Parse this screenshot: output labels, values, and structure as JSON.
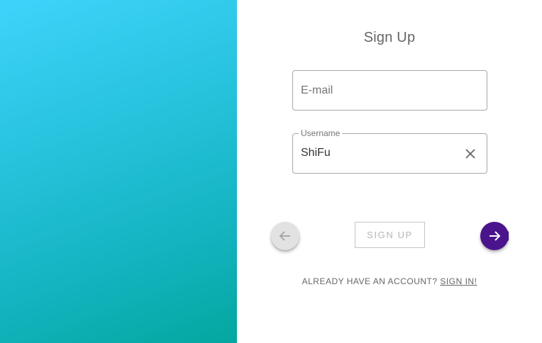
{
  "hero": {
    "gradient_start": "#3fd3fb",
    "gradient_end": "#04a79f"
  },
  "form": {
    "title": "Sign Up",
    "email": {
      "placeholder": "E-mail",
      "value": ""
    },
    "username": {
      "label": "Username",
      "value": "ShiFu"
    },
    "signup_label": "SIGN UP"
  },
  "nav": {
    "back_icon": "arrow-left-icon",
    "next_icon": "arrow-right-icon",
    "next_color": "#4a148c"
  },
  "footer": {
    "prompt": "ALREADY HAVE AN ACCOUNT?",
    "link": "SIGN IN!"
  }
}
